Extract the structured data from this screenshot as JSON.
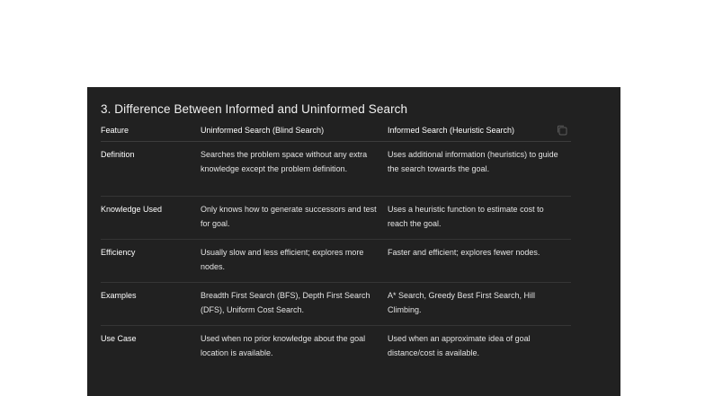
{
  "title": "3. Difference Between Informed and Uninformed Search",
  "columns": [
    "Feature",
    "Uninformed Search (Blind Search)",
    "Informed Search (Heuristic Search)"
  ],
  "rows": [
    {
      "feature": "Definition",
      "uninformed": "Searches the problem space without any extra knowledge except the problem definition.",
      "informed": "Uses additional information (heuristics) to guide the search towards the goal."
    },
    {
      "feature": "Knowledge Used",
      "uninformed": "Only knows how to generate successors and test for goal.",
      "informed": "Uses a heuristic function to estimate cost to reach the goal."
    },
    {
      "feature": "Efficiency",
      "uninformed": "Usually slow and less efficient; explores more nodes.",
      "informed": "Faster and efficient; explores fewer nodes."
    },
    {
      "feature": "Examples",
      "uninformed": "Breadth First Search (BFS), Depth First Search (DFS), Uniform Cost Search.",
      "informed": "A* Search, Greedy Best First Search, Hill Climbing."
    },
    {
      "feature": "Use Case",
      "uninformed": "Used when no prior knowledge about the goal location is available.",
      "informed": "Used when an approximate idea of goal distance/cost is available."
    }
  ],
  "icons": {
    "copy": "copy-icon"
  }
}
